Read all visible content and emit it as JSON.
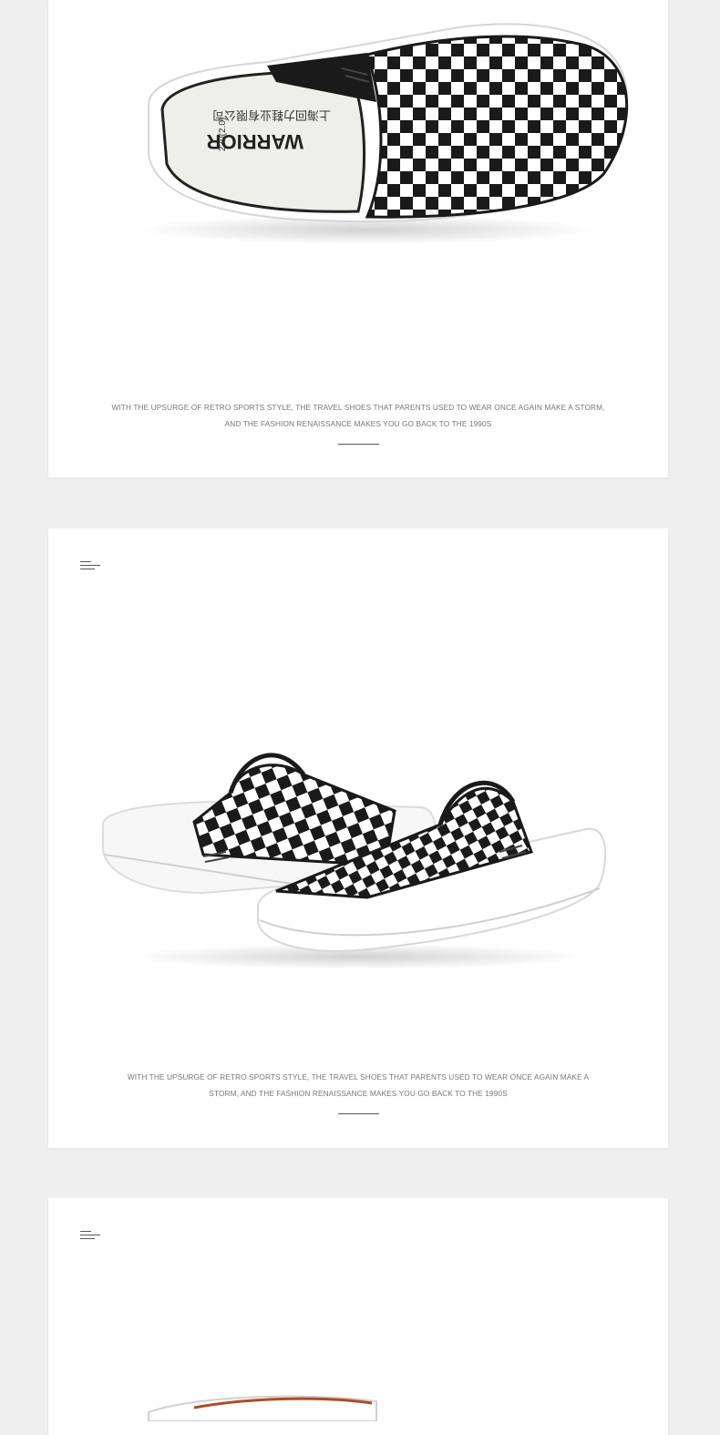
{
  "sections": [
    {
      "id": "section-1",
      "image": "checkered-mule-top-view",
      "insole_brand": "WARRIOR",
      "insole_company": "上海回力鞋业有限公司",
      "insole_size": "230(2.0)",
      "caption_lines": [
        "WITH THE UPSURGE OF RETRO SPORTS STYLE, THE TRAVEL SHOES THAT PARENTS USED TO WEAR ONCE AGAIN MAKE A STORM,",
        "AND THE FASHION RENAISSANCE MAKES YOU GO BACK TO THE 1990S"
      ]
    },
    {
      "id": "section-2",
      "menu_icon": "menu-lines-icon",
      "image": "checkered-mule-pair-side-view",
      "caption_lines": [
        "WITH THE UPSURGE OF RETRO SPORTS STYLE, THE TRAVEL SHOES THAT PARENTS USED TO WEAR ONCE AGAIN MAKE A",
        "STORM, AND THE FASHION RENAISSANCE MAKES YOU GO BACK TO THE 1990S"
      ]
    },
    {
      "id": "section-3",
      "menu_icon": "menu-lines-icon",
      "image": "checkered-mule-partial"
    }
  ],
  "colors": {
    "page_bg": "#efefef",
    "card_bg": "#ffffff",
    "caption": "#777777",
    "rule": "#555555"
  }
}
